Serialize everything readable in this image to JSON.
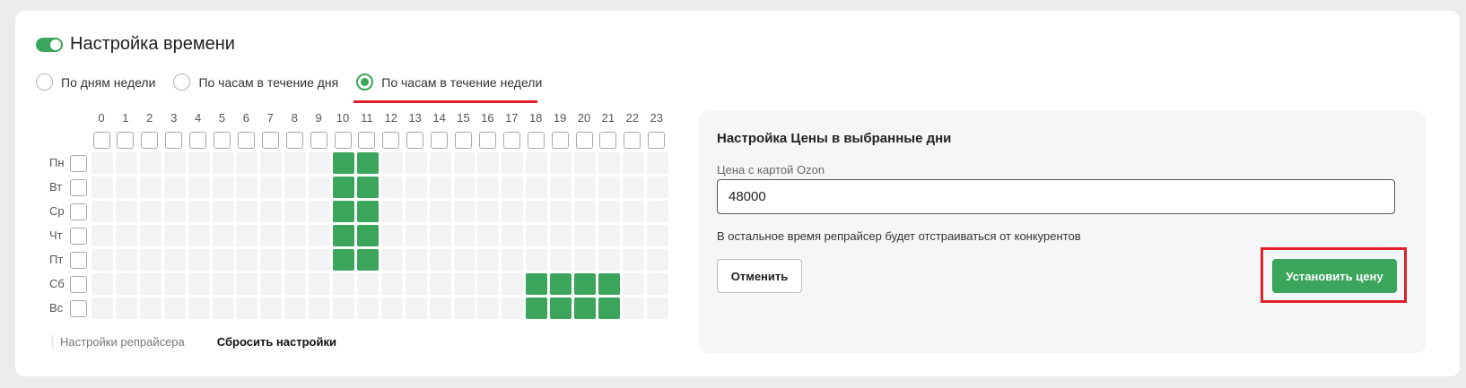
{
  "header": {
    "title": "Настройка времени",
    "toggle_on": true
  },
  "modes": [
    {
      "label": "По дням недели",
      "checked": false
    },
    {
      "label": "По часам в течение дня",
      "checked": false
    },
    {
      "label": "По часам в течение недели",
      "checked": true
    }
  ],
  "schedule": {
    "hours": [
      "0",
      "1",
      "2",
      "3",
      "4",
      "5",
      "6",
      "7",
      "8",
      "9",
      "10",
      "11",
      "12",
      "13",
      "14",
      "15",
      "16",
      "17",
      "18",
      "19",
      "20",
      "21",
      "22",
      "23"
    ],
    "days": [
      "Пн",
      "Вт",
      "Ср",
      "Чт",
      "Пт",
      "Сб",
      "Вс"
    ],
    "active": [
      [
        10,
        11
      ],
      [
        10,
        11
      ],
      [
        10,
        11
      ],
      [
        10,
        11
      ],
      [
        10,
        11
      ],
      [
        18,
        19,
        20,
        21
      ],
      [
        18,
        19,
        20,
        21
      ]
    ]
  },
  "footer": {
    "repricer_settings": "Настройки репрайсера",
    "reset_settings": "Сбросить настройки"
  },
  "panel": {
    "title": "Настройка Цены в выбранные дни",
    "price_label": "Цена с картой Ozon",
    "price_value": "48000",
    "note": "В остальное время репрайсер будет отстраиваться от конкурентов",
    "cancel_label": "Отменить",
    "save_label": "Установить цену"
  },
  "colors": {
    "accent": "#3aa55b",
    "highlight": "#e0202a",
    "cell_empty": "#f2f3f5"
  }
}
